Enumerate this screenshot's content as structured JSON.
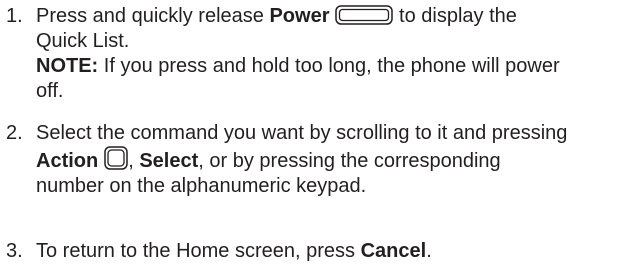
{
  "steps": [
    {
      "number": "1.",
      "lines": {
        "l1_pre": "Press and quickly release ",
        "l1_bold": "Power",
        "l1_post": " to display the",
        "l2": "Quick List.",
        "note_label": "NOTE:",
        "note_text_1": " If you press and hold too long, the phone will power",
        "note_text_2": "off."
      },
      "icon": "power-key-icon"
    },
    {
      "number": "2.",
      "lines": {
        "l1": "Select the command you want by scrolling to it and pressing",
        "l2_bold1": "Action",
        "l2_sep": ", ",
        "l2_bold2": "Select",
        "l2_post": ", or by pressing the corresponding",
        "l3": "number on the alphanumeric keypad."
      },
      "icon": "action-key-icon"
    },
    {
      "number": "3.",
      "lines": {
        "l1_pre": "To return to the Home screen, press ",
        "l1_bold": "Cancel",
        "l1_post": "."
      }
    }
  ],
  "colors": {
    "text": "#231f20",
    "background": "#ffffff"
  }
}
